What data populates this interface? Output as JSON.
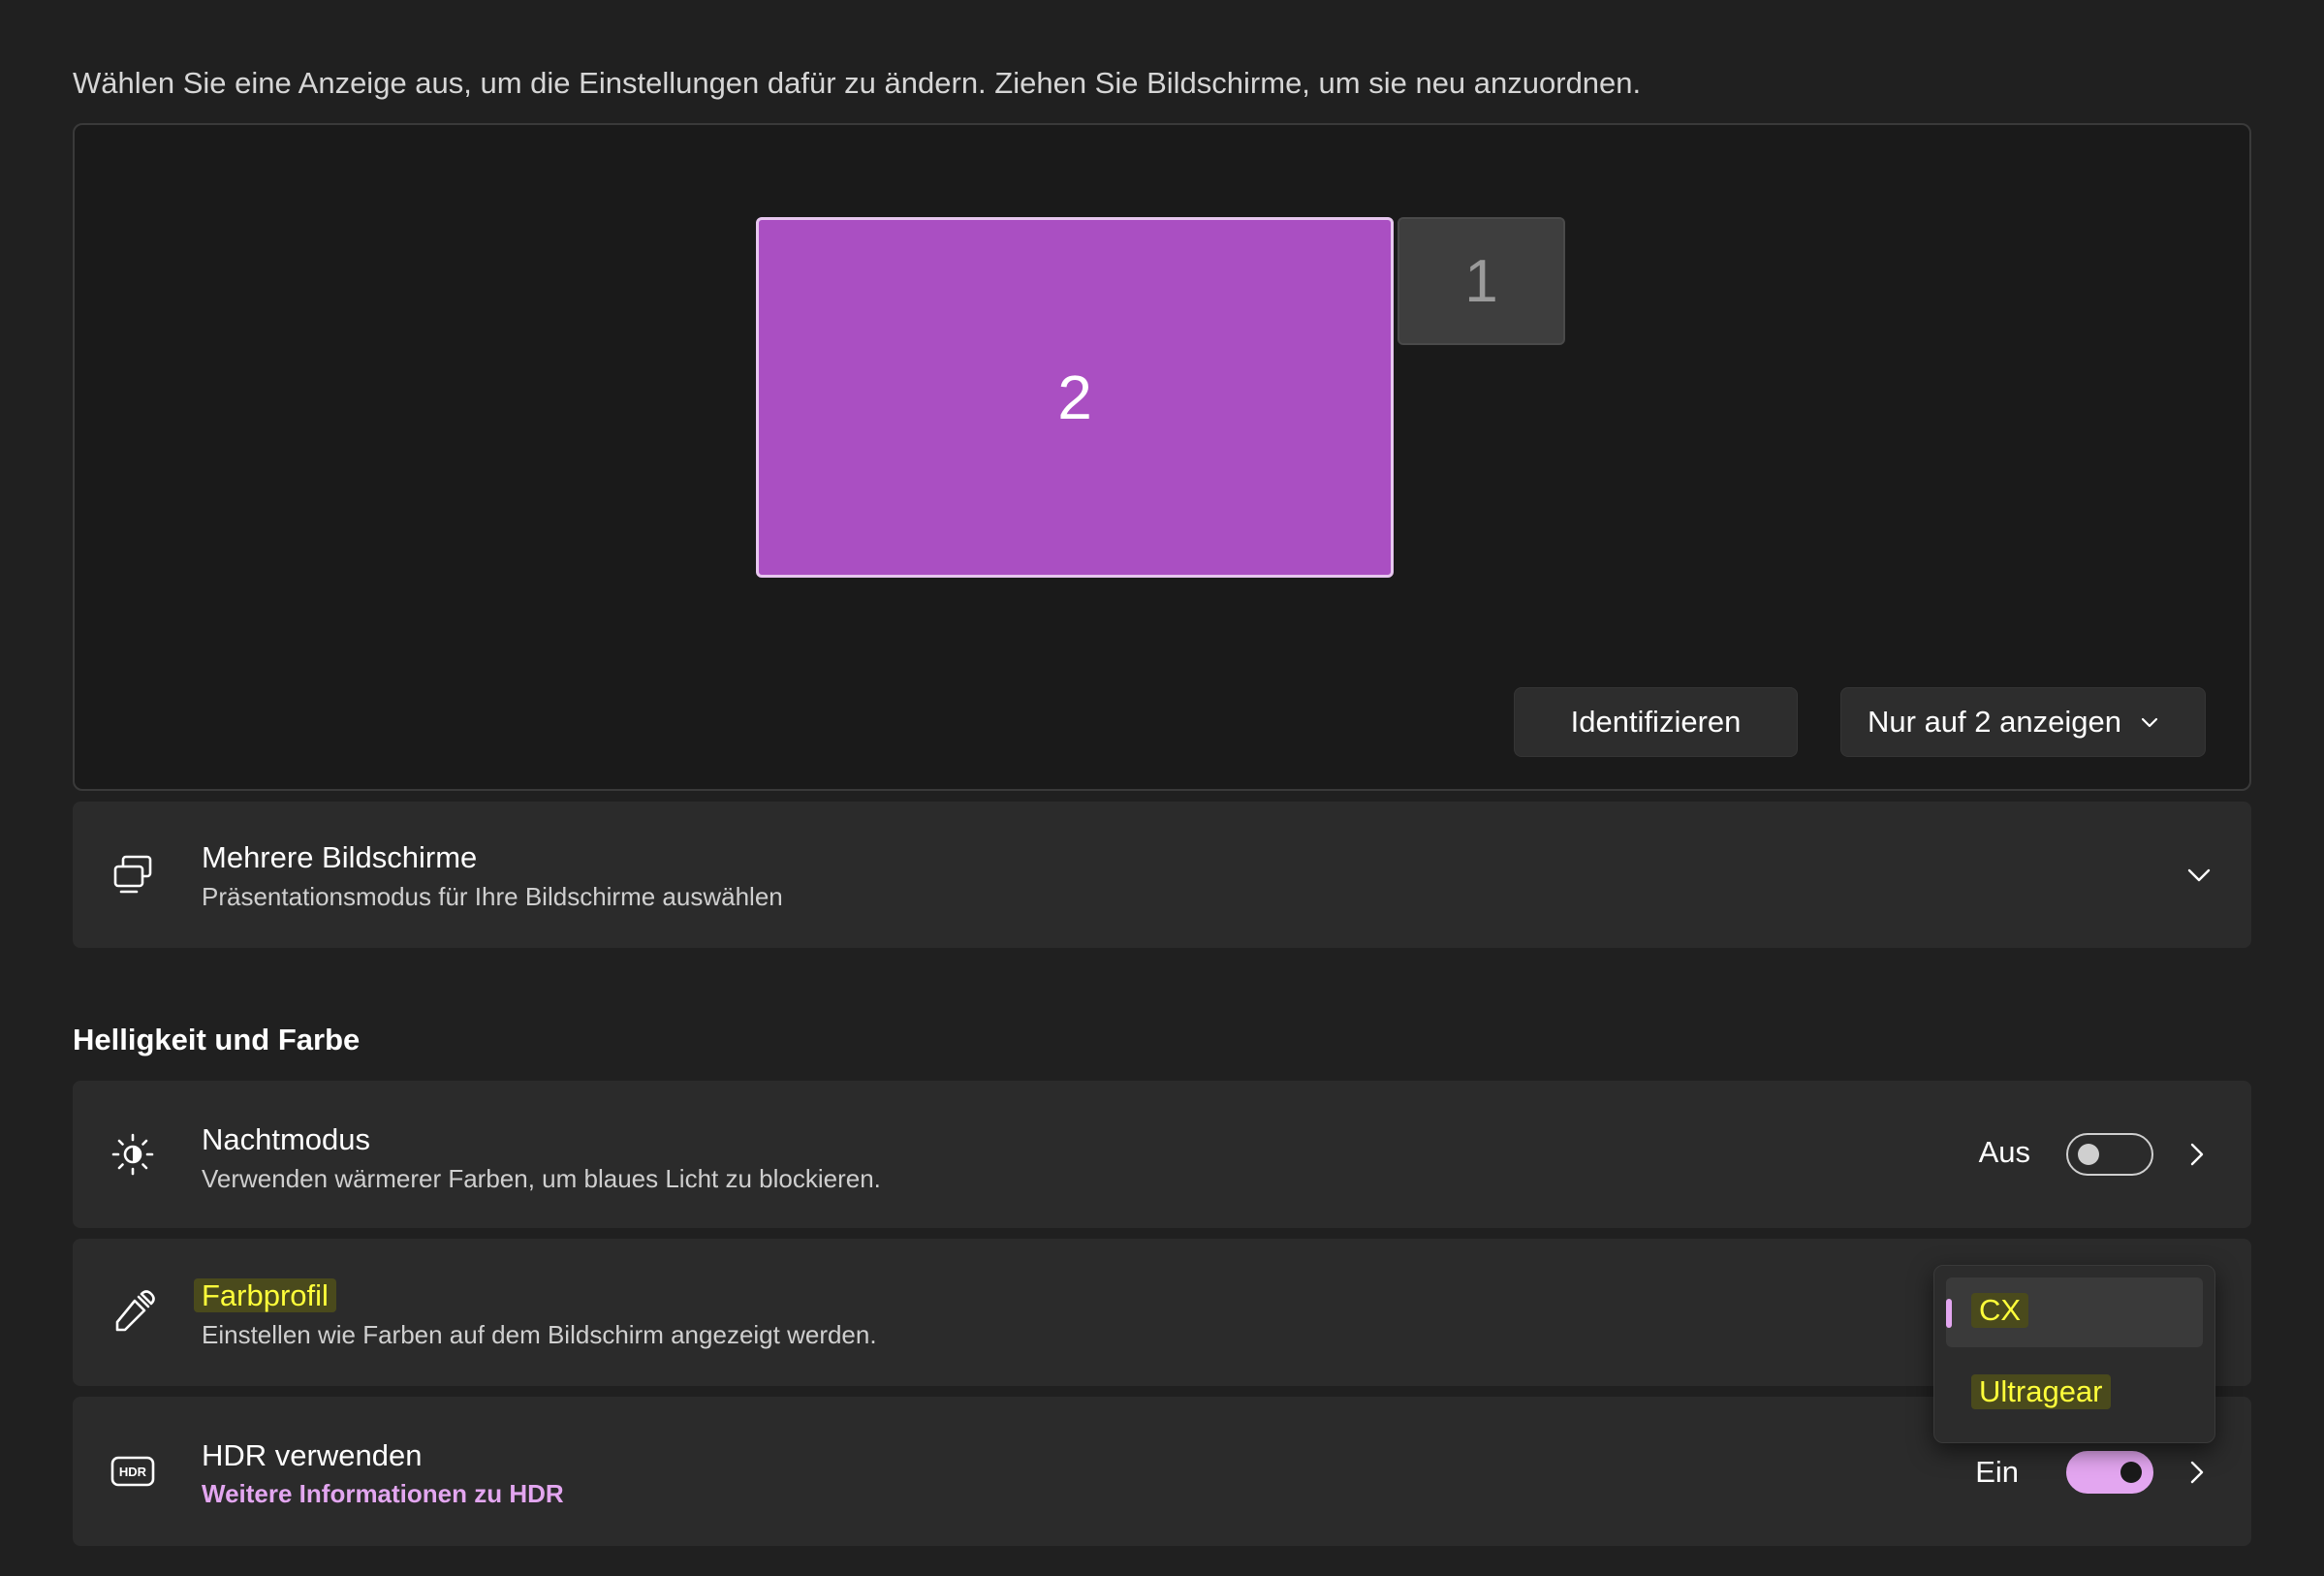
{
  "intro_text": "Wählen Sie eine Anzeige aus, um die Einstellungen dafür zu ändern. Ziehen Sie Bildschirme, um sie neu anzuordnen.",
  "arrangement": {
    "monitors": [
      {
        "label": "2",
        "selected": true,
        "color": "#aa4fc2"
      },
      {
        "label": "1",
        "selected": false,
        "color": "#3e3e3e"
      }
    ],
    "identify_label": "Identifizieren",
    "display_mode_label": "Nur auf 2 anzeigen"
  },
  "multiple_displays": {
    "title": "Mehrere Bildschirme",
    "description": "Präsentationsmodus für Ihre Bildschirme auswählen"
  },
  "brightness_section": {
    "title": "Helligkeit und Farbe",
    "night_mode": {
      "title": "Nachtmodus",
      "description": "Verwenden wärmerer Farben, um blaues Licht zu blockieren.",
      "state_label": "Aus",
      "on": false
    },
    "color_profile": {
      "title": "Farbprofil",
      "description": "Einstellen wie Farben auf dem Bildschirm angezeigt werden.",
      "options": [
        "CX",
        "Ultragear"
      ],
      "selected": "CX"
    },
    "hdr": {
      "title": "HDR verwenden",
      "link": "Weitere Informationen zu HDR",
      "state_label": "Ein",
      "on": true
    }
  },
  "colors": {
    "accent": "#e3a6f0",
    "monitor_selected": "#aa4fc2",
    "highlight": "#ffff3a",
    "background": "#202020",
    "card": "#2b2b2b"
  }
}
